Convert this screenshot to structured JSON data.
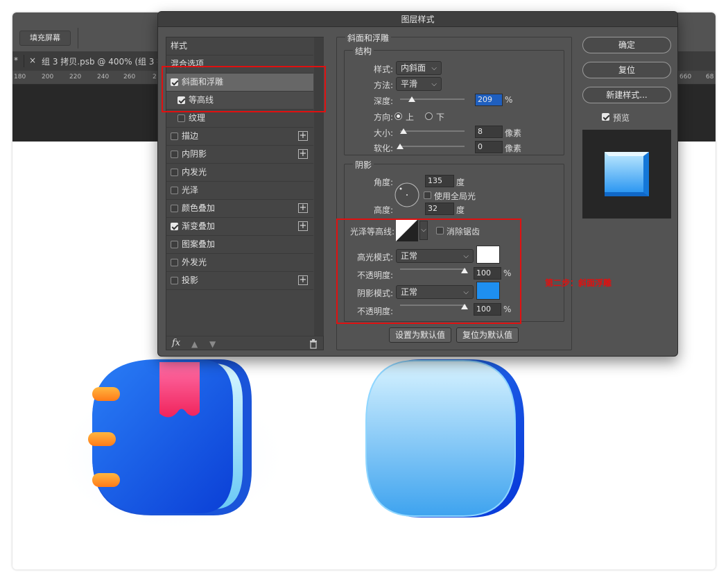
{
  "toolbar": {
    "fill_screen": "填充屏幕"
  },
  "tab": {
    "modified_mark": "*",
    "close_glyph": "×",
    "doc_title": "组 3 拷贝.psb @ 400% (组 3 拷",
    "sep": "|"
  },
  "ruler": {
    "ticks_left": [
      "180",
      "200",
      "220",
      "240",
      "260",
      "2"
    ],
    "ticks_right": [
      "660",
      "68"
    ]
  },
  "dialog": {
    "title": "图层样式",
    "left_panel": {
      "header_styles": "样式",
      "header_blend": "混合选项",
      "items": [
        {
          "label": "斜面和浮雕",
          "checked": true,
          "selected": true,
          "plus": false
        },
        {
          "label": "等高线",
          "checked": true,
          "sub": true,
          "plus": false
        },
        {
          "label": "纹理",
          "checked": false,
          "sub": true,
          "plus": false
        },
        {
          "label": "描边",
          "checked": false,
          "plus": true
        },
        {
          "label": "内阴影",
          "checked": false,
          "plus": true
        },
        {
          "label": "内发光",
          "checked": false,
          "plus": false
        },
        {
          "label": "光泽",
          "checked": false,
          "plus": false
        },
        {
          "label": "颜色叠加",
          "checked": false,
          "plus": true
        },
        {
          "label": "渐变叠加",
          "checked": true,
          "plus": true
        },
        {
          "label": "图案叠加",
          "checked": false,
          "plus": false
        },
        {
          "label": "外发光",
          "checked": false,
          "plus": false
        },
        {
          "label": "投影",
          "checked": false,
          "plus": true
        }
      ],
      "fx_label": "fx"
    },
    "bevel": {
      "group_title": "斜面和浮雕",
      "structure_title": "结构",
      "style_label": "样式:",
      "style_value": "内斜面",
      "method_label": "方法:",
      "method_value": "平滑",
      "depth_label": "深度:",
      "depth_value": "209",
      "depth_unit": "%",
      "direction_label": "方向:",
      "dir_up": "上",
      "dir_down": "下",
      "size_label": "大小:",
      "size_value": "8",
      "size_unit": "像素",
      "soften_label": "软化:",
      "soften_value": "0",
      "soften_unit": "像素",
      "shading_title": "阴影",
      "angle_label": "角度:",
      "angle_value": "135",
      "angle_unit": "度",
      "global_light": "使用全局光",
      "altitude_label": "高度:",
      "altitude_value": "32",
      "altitude_unit": "度",
      "gloss_label": "光泽等高线:",
      "anti_alias": "消除锯齿",
      "highlight_mode_label": "高光模式:",
      "highlight_mode_value": "正常",
      "highlight_color": "#ffffff",
      "highlight_opacity_label": "不透明度:",
      "highlight_opacity_value": "100",
      "highlight_opacity_unit": "%",
      "shadow_mode_label": "阴影模式:",
      "shadow_mode_value": "正常",
      "shadow_color": "#1e8ff0",
      "shadow_opacity_label": "不透明度:",
      "shadow_opacity_value": "100",
      "shadow_opacity_unit": "%",
      "make_default": "设置为默认值",
      "reset_default": "复位为默认值"
    },
    "right": {
      "ok": "确定",
      "reset": "复位",
      "new_style": "新建样式...",
      "preview": "预览"
    }
  },
  "annotation": {
    "step_note": "第二步：斜面浮雕"
  },
  "colors": {
    "red": "#e01010",
    "blue": "#1e8ff0",
    "panel": "#535353"
  }
}
